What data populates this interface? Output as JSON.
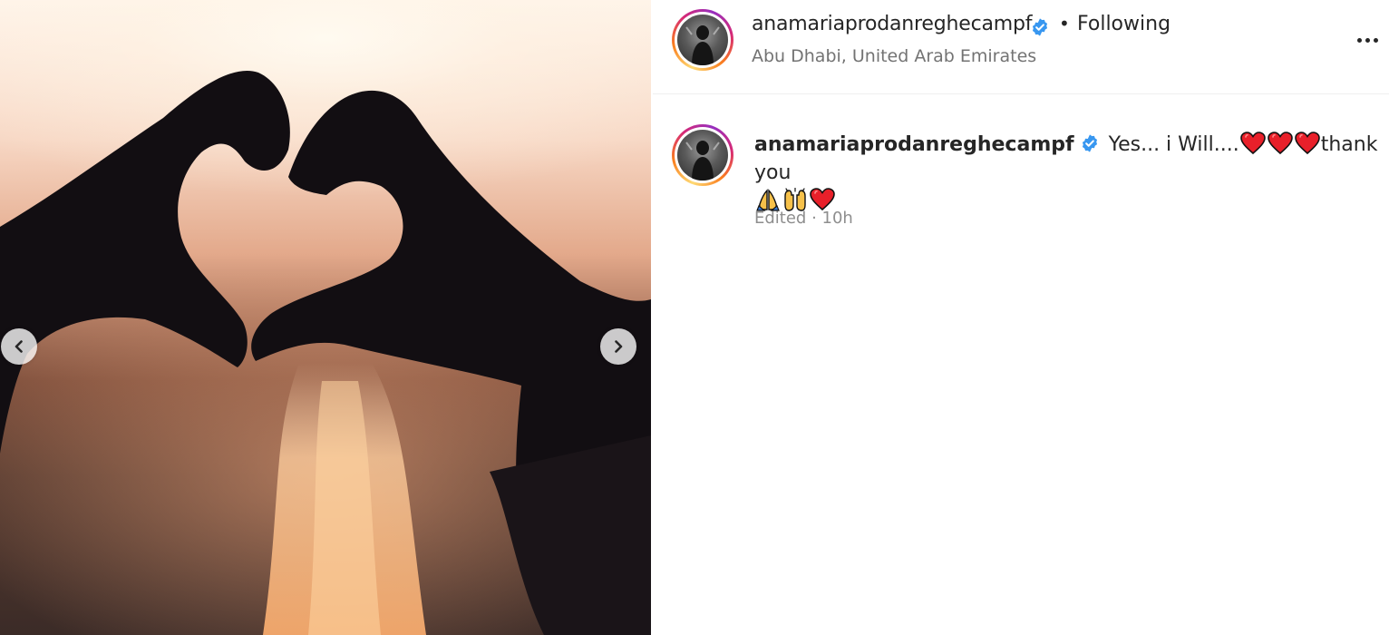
{
  "post": {
    "username": "anamariaprodanreghecampf",
    "separator": "•",
    "follow_status": "Following",
    "location": "Abu Dhabi, United Arab Emirates"
  },
  "caption": {
    "username": "anamariaprodanreghecampf",
    "text_part1": "Yes... i Will....",
    "text_part2": "thank you",
    "edited_label": "Edited",
    "meta_separator": " · ",
    "time_ago": "10h"
  },
  "media": {
    "description_icon": "heart-hands-sunset-photo",
    "prev_icon": "chevron-left-icon",
    "next_icon": "chevron-right-icon"
  },
  "colors": {
    "verified_blue": "#3897f0",
    "heart_red": "#e8202a",
    "secondary_text": "#737373"
  }
}
